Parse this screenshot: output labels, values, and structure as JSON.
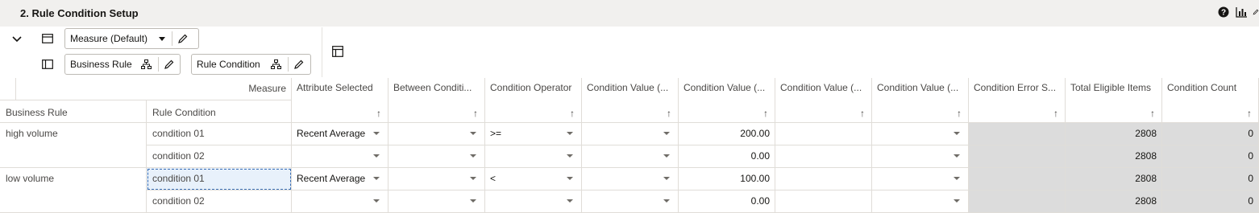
{
  "title": "2. Rule Condition Setup",
  "toolbar": {
    "measure_select": "Measure (Default)",
    "row_pill_1": "Business Rule",
    "row_pill_2": "Rule Condition"
  },
  "grid": {
    "corner_label": "Measure",
    "row_dim_headers": [
      "Business Rule",
      "Rule Condition"
    ],
    "columns": [
      "Attribute Selected",
      "Between Conditi...",
      "Condition Operator",
      "Condition Value (...",
      "Condition Value (...",
      "Condition Value (...",
      "Condition Value (...",
      "Condition Error S...",
      "Total Eligible Items",
      "Condition Count"
    ],
    "rows": [
      {
        "rule": "high volume",
        "condition": "condition 01",
        "attr": "Recent Average",
        "between": "",
        "operator": ">=",
        "cv1": "",
        "cv2": "200.00",
        "cv3": "",
        "cv4": "",
        "err": "",
        "total": "2808",
        "count": "0"
      },
      {
        "rule": "",
        "condition": "condition 02",
        "attr": "",
        "between": "",
        "operator": "",
        "cv1": "",
        "cv2": "0.00",
        "cv3": "",
        "cv4": "",
        "err": "",
        "total": "2808",
        "count": "0"
      },
      {
        "rule": "low volume",
        "condition": "condition 01",
        "attr": "Recent Average",
        "between": "",
        "operator": "<",
        "cv1": "",
        "cv2": "100.00",
        "cv3": "",
        "cv4": "",
        "err": "",
        "total": "2808",
        "count": "0"
      },
      {
        "rule": "",
        "condition": "condition 02",
        "attr": "",
        "between": "",
        "operator": "",
        "cv1": "",
        "cv2": "0.00",
        "cv3": "",
        "cv4": "",
        "err": "",
        "total": "2808",
        "count": "0"
      }
    ]
  },
  "icons": [
    "help-icon",
    "chart-icon",
    "edit-icon",
    "chevron-down-icon",
    "layout-icon",
    "panel-icon",
    "hierarchy-icon",
    "pencil-icon",
    "pivot-icon",
    "sort-arrow-icon",
    "dropdown-arrow-icon"
  ]
}
